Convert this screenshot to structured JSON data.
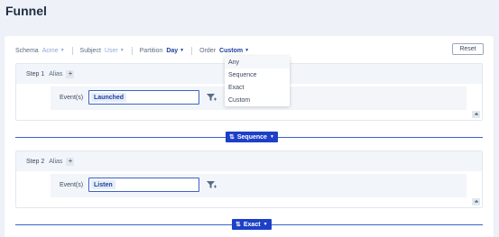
{
  "page": {
    "title": "Funnel"
  },
  "toolbar": {
    "schema_label": "Schema",
    "schema_value": "Acme",
    "subject_label": "Subject",
    "subject_value": "User",
    "partition_label": "Partition",
    "partition_value": "Day",
    "order_label": "Order",
    "order_value": "Custom",
    "reset_label": "Reset"
  },
  "order_menu": {
    "options": [
      "Any",
      "Sequence",
      "Exact",
      "Custom"
    ]
  },
  "steps": [
    {
      "label": "Step 1",
      "alias_label": "Alias",
      "add_symbol": "+",
      "events_label": "Event(s)",
      "event_value": "Launched"
    },
    {
      "label": "Step 2",
      "alias_label": "Alias",
      "add_symbol": "+",
      "events_label": "Event(s)",
      "event_value": "Listen"
    }
  ],
  "connectors": [
    {
      "label": "Sequence"
    },
    {
      "label": "Exact"
    }
  ],
  "colors": {
    "accent": "#1d40c8",
    "link": "#1d3f9c",
    "muted_link": "#8ea9d6",
    "panel": "#f2f5f9"
  },
  "icons": [
    "filter-icon",
    "collapse-icon",
    "swap-icon",
    "caret-down-icon"
  ]
}
